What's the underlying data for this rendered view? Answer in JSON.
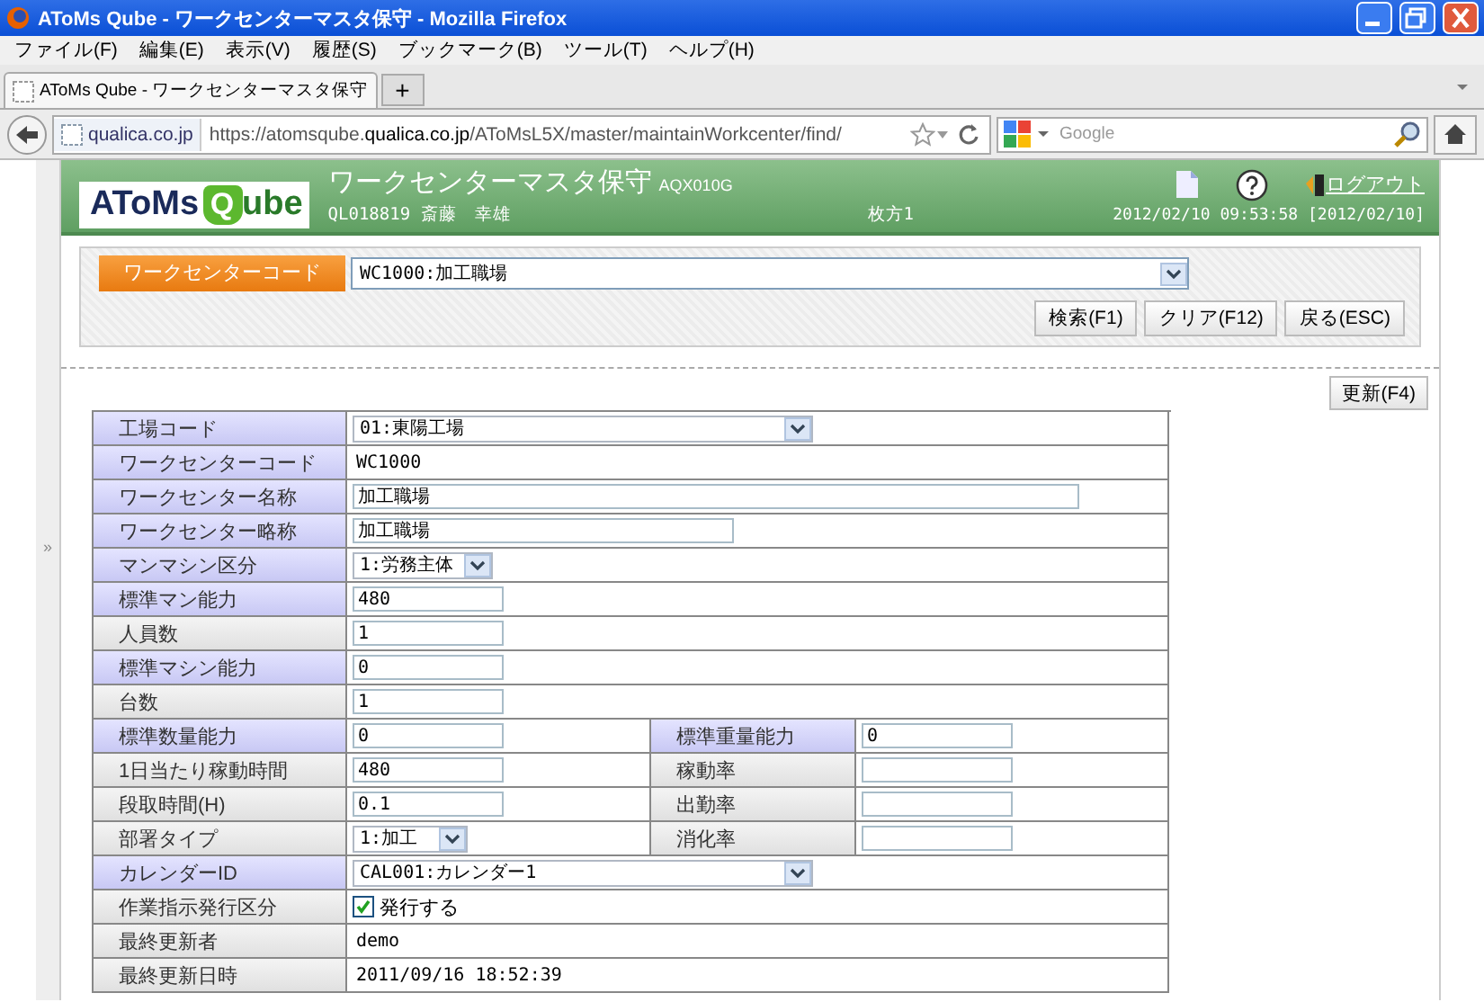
{
  "browser": {
    "title": "AToMs Qube - ワークセンターマスタ保守 - Mozilla Firefox",
    "menu": [
      "ファイル(F)",
      "編集(E)",
      "表示(V)",
      "履歴(S)",
      "ブックマーク(B)",
      "ツール(T)",
      "ヘルプ(H)"
    ],
    "tab": {
      "label": "AToMs Qube - ワークセンターマスタ保守",
      "selected": true
    },
    "new_tab": "+",
    "site": "qualica.co.jp",
    "url": "https://atomsqube.**qualica.co.jp**/AToMsL5X/master/maintainWorkcenter/find/",
    "search": {
      "placeholder": "Google"
    }
  },
  "side_toggle": "»",
  "header": {
    "logo_left": "AToMs",
    "logo_mark": "Q",
    "logo_right": "ube",
    "title": "ワークセンターマスタ保守",
    "screen_id": "AQX010G",
    "user": "QL018819 斎藤　幸雄",
    "site": "枚方1",
    "datetime": "2012/02/10 09:53:58 [2012/02/10]",
    "logout": "ログアウト"
  },
  "search_panel": {
    "label": "ワークセンターコード",
    "value": "WC1000:加工職場",
    "buttons": [
      "検索(F1)",
      "クリア(F12)",
      "戻る(ESC)"
    ]
  },
  "update_button": "更新(F4)",
  "rows": [
    {
      "label": "工場コード",
      "required": true,
      "kind": "select",
      "value": "01:東陽工場"
    },
    {
      "label": "ワークセンターコード",
      "required": true,
      "kind": "plain",
      "value": "WC1000"
    },
    {
      "label": "ワークセンター名称",
      "required": true,
      "kind": "wide-input",
      "value": "加工職場"
    },
    {
      "label": "ワークセンター略称",
      "required": true,
      "kind": "input",
      "value": "加工職場"
    },
    {
      "label": "マンマシン区分",
      "required": true,
      "kind": "short-select",
      "value": "1:労務主体"
    },
    {
      "label": "標準マン能力",
      "required": true,
      "kind": "number-input",
      "value": "480"
    },
    {
      "label": "人員数",
      "required": false,
      "kind": "number-input",
      "value": "1"
    },
    {
      "label": "標準マシン能力",
      "required": true,
      "kind": "number-input",
      "value": "0"
    },
    {
      "label": "台数",
      "required": false,
      "kind": "number-input",
      "value": "1"
    },
    {
      "label": "標準数量能力",
      "required": true,
      "kind": "number-input",
      "value": "0",
      "extra": {
        "label": "標準重量能力",
        "required": true,
        "kind": "number-input",
        "value": "0"
      }
    },
    {
      "label": "1日当たり稼動時間",
      "required": false,
      "kind": "number-input",
      "value": "480",
      "extra": {
        "label": "稼動率",
        "required": false,
        "kind": "number-input"
      }
    },
    {
      "label": "段取時間(H)",
      "required": false,
      "kind": "number-input",
      "value": "0.1",
      "extra": {
        "label": "出勤率",
        "required": false,
        "kind": "number-input"
      }
    },
    {
      "label": "部署タイプ",
      "required": false,
      "kind": "short-select",
      "value": "1:加工",
      "extra": {
        "label": "消化率",
        "required": false,
        "kind": "number-input"
      }
    },
    {
      "label": "カレンダーID",
      "required": true,
      "kind": "select",
      "value": "CAL001:カレンダー1"
    },
    {
      "label": "作業指示発行区分",
      "required": false,
      "kind": "checkbox",
      "checked": true,
      "value": "発行する"
    },
    {
      "label": "最終更新者",
      "required": false,
      "kind": "plain",
      "value": "demo"
    },
    {
      "label": "最終更新日時",
      "required": false,
      "kind": "plain",
      "value": "2011/09/16 18:52:39"
    }
  ]
}
